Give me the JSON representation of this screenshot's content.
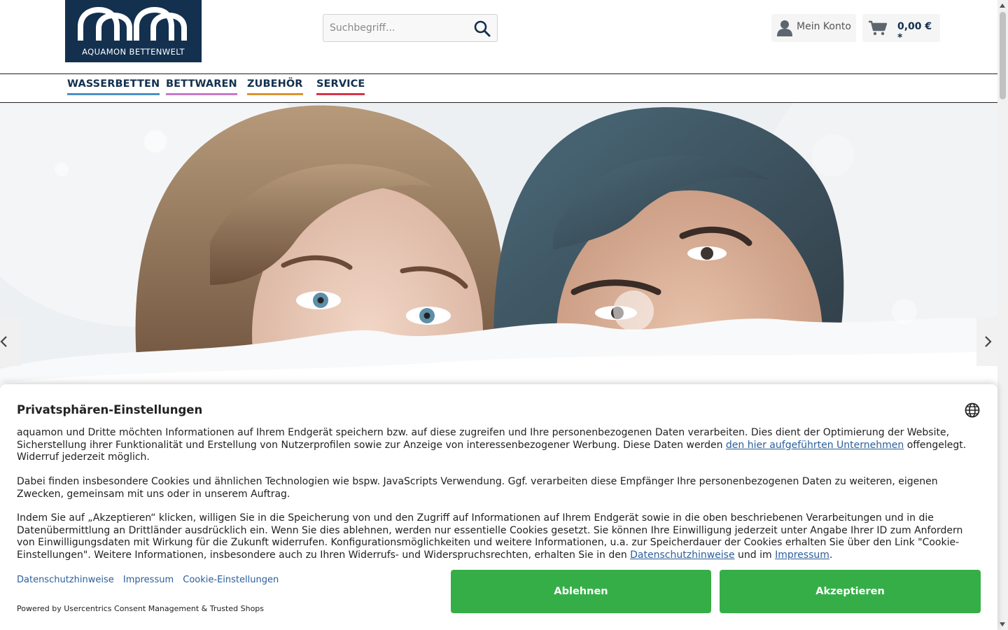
{
  "logo": {
    "text": "AQUAMON BETTENWELT",
    "brand_color": "#13304f"
  },
  "search": {
    "placeholder": "Suchbegriff...",
    "icon": "search-icon"
  },
  "account": {
    "label": "Mein Konto",
    "icon": "user-icon"
  },
  "cart": {
    "total": "0,00 € *",
    "icon": "cart-icon"
  },
  "nav": {
    "items": [
      {
        "label": "WASSERBETTEN",
        "color": "#4a90c9"
      },
      {
        "label": "BETTWAREN",
        "color": "#c979c9"
      },
      {
        "label": "ZUBEHÖR",
        "color": "#d9952b"
      },
      {
        "label": "SERVICE",
        "color": "#d9334a"
      }
    ]
  },
  "hero": {
    "prev_icon": "chevron-left-icon",
    "next_icon": "chevron-right-icon"
  },
  "consent": {
    "title": "Privatsphären-Einstellungen",
    "p1_a": "aquamon und Dritte möchten Informationen auf Ihrem Endgerät speichern bzw. auf diese zugreifen und Ihre personenbezogenen Daten verarbeiten. Dies dient der Optimierung der Website, Sicherstellung ihrer Funktionalität und Erstellung von Nutzerprofilen sowie zur Anzeige von interessenbezogener Werbung. Diese Daten werden ",
    "p1_link": "den hier aufgeführten Unternehmen",
    "p1_b": " offengelegt. Widerruf jederzeit möglich.",
    "p2": "Dabei finden insbesondere Cookies und ähnlichen Technologien wie bspw. JavaScripts Verwendung. Ggf. verarbeiten diese Empfänger Ihre personenbezogenen Daten zu weiteren, eigenen Zwecken, gemeinsam mit uns oder in unserem Auftrag.",
    "p3_a": "Indem Sie auf „Akzeptieren“ klicken, willigen Sie in die Speicherung von und den Zugriff auf Informationen auf Ihrem Endgerät sowie in die oben beschriebenen Verarbeitungen und in die Datenübermittlung an Drittländer ausdrücklich ein. Wenn Sie dies ablehnen, werden nur essentielle Cookies gesetzt. Sie können Ihre Einwilligung jederzeit unter Angabe Ihrer ID zum Anfordern von Einwilligungsdaten mit Wirkung für die Zukunft widerrufen. Konfigurationsmöglichkeiten und weitere Informationen, u.a. zur Speicherdauer der Cookies erhalten Sie über den Link \"Cookie-Einstellungen\". Weitere Informationen, insbesondere auch zu Ihren Widerrufs- und Widerspruchsrechten, erhalten Sie in den ",
    "p3_link1": "Datenschutzhinweise",
    "p3_mid": " und im ",
    "p3_link2": "Impressum",
    "p3_end": ".",
    "links": [
      "Datenschutzhinweise",
      "Impressum",
      "Cookie-Einstellungen"
    ],
    "powered": "Powered by Usercentrics Consent Management & Trusted Shops",
    "deny": "Ablehnen",
    "accept": "Akzeptieren",
    "button_color": "#36ae48",
    "globe_icon": "globe-icon"
  }
}
